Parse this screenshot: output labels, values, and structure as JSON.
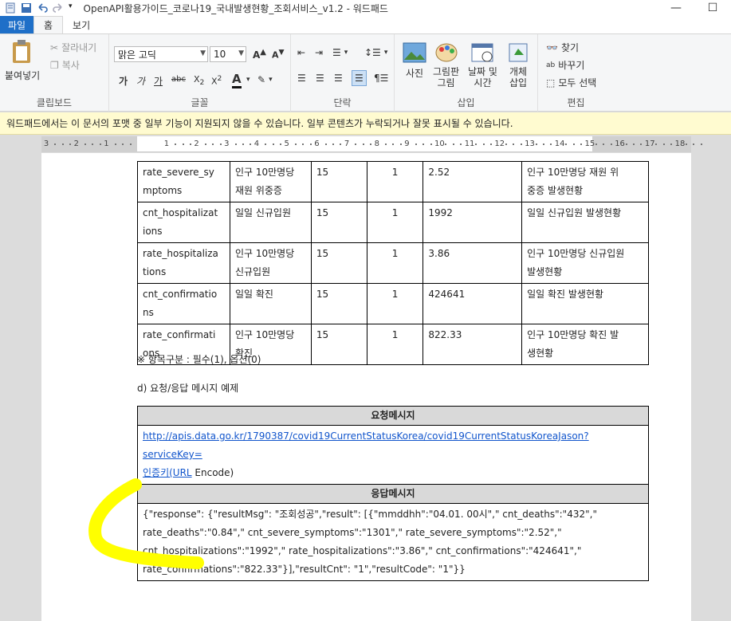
{
  "window": {
    "title": "OpenAPI활용가이드_코로나19_국내발생현황_조회서비스_v1.2 - 워드패드"
  },
  "tabs": [
    "파일",
    "홈",
    "보기"
  ],
  "ribbon": {
    "clipboard": {
      "paste": "붙여넣기",
      "cut": "잘라내기",
      "copy": "복사",
      "label": "클립보드"
    },
    "font": {
      "family": "맑은 고딕",
      "size": "10",
      "label": "글꼴"
    },
    "paragraph": {
      "label": "단락"
    },
    "insert": {
      "picture": "사진",
      "paint": "그림판\n그림",
      "datetime": "날짜 및\n시간",
      "object": "개체\n삽입",
      "label": "삽입"
    },
    "editing": {
      "find": "찾기",
      "replace": "바꾸기",
      "select_all": "모두 선택",
      "label": "편집"
    }
  },
  "notice": "워드패드에서는 이 문서의 포맷 중 일부 기능이 지원되지 않을 수 있습니다. 일부 콘텐츠가 누락되거나 잘못 표시될 수 있습니다.",
  "ruler": [
    "3",
    "2",
    "1",
    "1",
    "2",
    "3",
    "4",
    "5",
    "6",
    "7",
    "8",
    "9",
    "10",
    "11",
    "12",
    "13",
    "14",
    "15",
    "16",
    "17",
    "18"
  ],
  "table_rows": [
    {
      "name": "rate_severe_sy\nmptoms",
      "desc": "인구 10만명당\n재원 위중증",
      "size": "15",
      "req": "1",
      "sample": "2.52",
      "note": "인구 10만명당 재원 위\n중증 발생현황"
    },
    {
      "name": "cnt_hospitalizat\nions",
      "desc": "일일 신규입원",
      "size": "15",
      "req": "1",
      "sample": "1992",
      "note": "일일 신규입원 발생현황"
    },
    {
      "name": "rate_hospitaliza\ntions",
      "desc": "인구 10만명당\n신규입원",
      "size": "15",
      "req": "1",
      "sample": "3.86",
      "note": "인구 10만명당 신규입원\n발생현황"
    },
    {
      "name": "cnt_confirmatio\nns",
      "desc": "일일 확진",
      "size": "15",
      "req": "1",
      "sample": "424641",
      "note": "일일 확진 발생현황"
    },
    {
      "name": "rate_confirmati\nons",
      "desc": "인구 10만명당\n확진",
      "size": "15",
      "req": "1",
      "sample": "822.33",
      "note": "인구 10만명당 확진 발\n생현황"
    }
  ],
  "footnote": "※ 항목구분 : 필수(1), 옵션(0)",
  "subhead": "d) 요청/응답 메시지 예제",
  "request": {
    "header": "요청메시지",
    "url_part1": "http://apis.data.go.kr/1790387/covid19CurrentStatusKorea/covid19CurrentStatusKoreaJason?serviceKey=",
    "url_part2": "인증키(URL",
    "url_tail": " Encode)"
  },
  "response": {
    "header": "응답메시지",
    "lines": [
      "{\"response\": {\"resultMsg\": \"조회성공\",\"result\": [{\"mmddhh\":\"04.01. 00시\",\" cnt_deaths\":\"432\",\"",
      "rate_deaths\":\"0.84\",\" cnt_severe_symptoms\":\"1301\",\"   rate_severe_symptoms\":\"2.52\",\"",
      "cnt_hospitalizations\":\"1992\",\"   rate_hospitalizations\":\"3.86\",\"  cnt_confirmations\":\"424641\",\"",
      "rate_confirmations\":\"822.33\"}],\"resultCnt\":  \"1\",\"resultCode\": \"1\"}}"
    ]
  },
  "colors": {
    "file_tab": "#1e6fc8",
    "notice_bg": "#fffbd0",
    "marker": "#ffff00",
    "link": "#1155cc"
  }
}
